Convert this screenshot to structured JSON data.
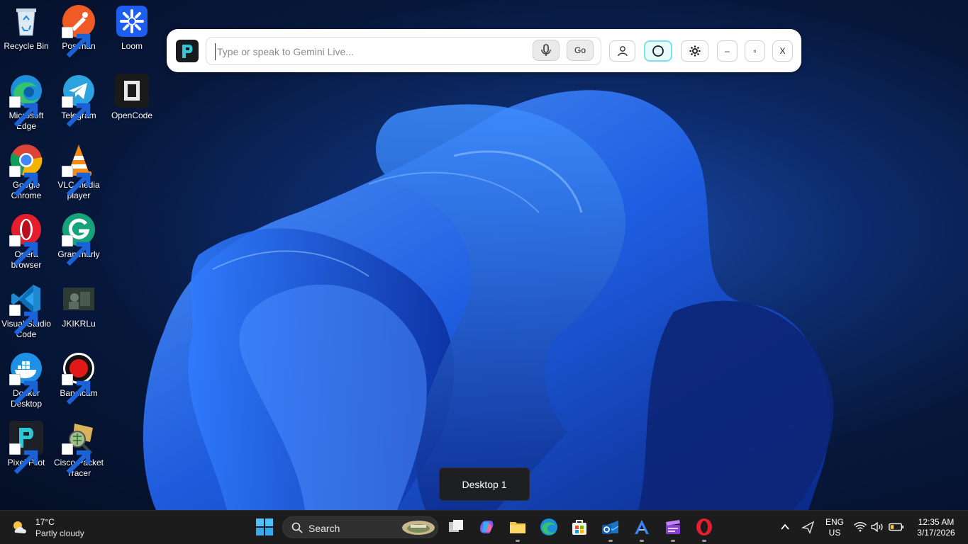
{
  "desktop_icons": [
    {
      "label": "Recycle Bin",
      "icon": "recycle-bin-icon"
    },
    {
      "label": "Postman",
      "icon": "postman-icon"
    },
    {
      "label": "Loom",
      "icon": "loom-icon"
    },
    {
      "label": "Microsoft Edge",
      "icon": "edge-icon"
    },
    {
      "label": "Telegram",
      "icon": "telegram-icon"
    },
    {
      "label": "OpenCode",
      "icon": "opencode-icon"
    },
    {
      "label": "Google Chrome",
      "icon": "chrome-icon"
    },
    {
      "label": "VLC media player",
      "icon": "vlc-icon"
    },
    {
      "label": "Opera browser",
      "icon": "opera-icon"
    },
    {
      "label": "Grammarly",
      "icon": "grammarly-icon"
    },
    {
      "label": "Visual Studio Code",
      "icon": "vscode-icon"
    },
    {
      "label": "JKIKRLu",
      "icon": "video-file-icon"
    },
    {
      "label": "Docker Desktop",
      "icon": "docker-icon"
    },
    {
      "label": "Bandicam",
      "icon": "bandicam-icon"
    },
    {
      "label": "Pixel Pilot",
      "icon": "pixel-pilot-icon"
    },
    {
      "label": "Cisco Packet Tracer",
      "icon": "packet-tracer-icon"
    }
  ],
  "gemini_bar": {
    "placeholder": "Type or speak to Gemini Live...",
    "go_label": "Go",
    "min_label": "–",
    "max_label": "▫",
    "close_label": "X"
  },
  "desktop_label": "Desktop 1",
  "taskbar": {
    "weather_temp": "17°C",
    "weather_condition": "Partly cloudy",
    "search_label": "Search",
    "language_line1": "ENG",
    "language_line2": "US",
    "time": "12:35 AM",
    "date": "3/17/2026"
  },
  "colors": {
    "accent_cyan": "#7ee0e6",
    "taskbar_bg": "#1c1c1c",
    "wallpaper_blue": "#1a4aa8"
  }
}
